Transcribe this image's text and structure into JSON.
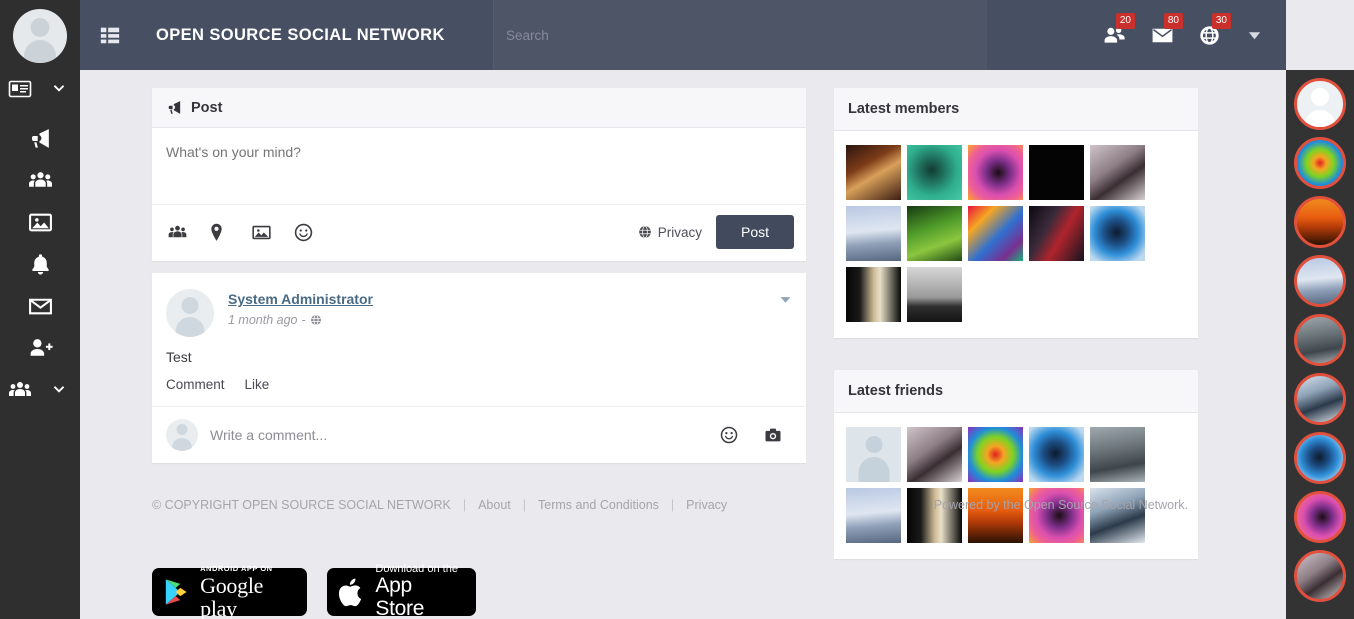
{
  "colors": {
    "header_bg": "#474f63",
    "search_bg": "#4e5567",
    "sidebar_bg": "#2f2f2f",
    "chat_strip_bg": "#333333",
    "page_bg": "#eaeaee",
    "badge_red": "#c9302c",
    "post_button_bg": "#424a5e",
    "link_blue": "#4a6b86",
    "chat_avatar_ring": "#e0503c"
  },
  "header": {
    "menu_toggle_icon": "th-list-icon",
    "brand": "OPEN SOURCE SOCIAL NETWORK",
    "search": {
      "placeholder": "Search",
      "value": ""
    },
    "notifications": [
      {
        "name": "friend-requests",
        "icon": "friends-icon",
        "count": "20"
      },
      {
        "name": "messages",
        "icon": "envelope-icon",
        "count": "80"
      },
      {
        "name": "alerts",
        "icon": "bell-globe-icon",
        "count": "30"
      }
    ],
    "user_menu_icon": "caret-down-icon"
  },
  "sidebar": {
    "avatar": "user-placeholder-avatar",
    "items": [
      {
        "name": "newsfeed",
        "icon": "id-card-icon",
        "has_chevron": true
      },
      {
        "name": "announcements",
        "icon": "megaphone-icon",
        "has_chevron": false
      },
      {
        "name": "groups",
        "icon": "group-icon",
        "has_chevron": false
      },
      {
        "name": "photos",
        "icon": "image-icon",
        "has_chevron": false
      },
      {
        "name": "notifications",
        "icon": "bell-icon",
        "has_chevron": false
      },
      {
        "name": "messages",
        "icon": "envelope-icon",
        "has_chevron": false
      },
      {
        "name": "add-friend",
        "icon": "user-plus-icon",
        "has_chevron": false
      },
      {
        "name": "communities",
        "icon": "group-icon",
        "has_chevron": true
      }
    ]
  },
  "composer": {
    "title": "Post",
    "title_icon": "megaphone-icon",
    "placeholder": "What's on your mind?",
    "value": "",
    "actions": [
      {
        "name": "tag-friends",
        "icon": "friends-icon"
      },
      {
        "name": "add-location",
        "icon": "map-pin-icon"
      },
      {
        "name": "add-photo",
        "icon": "image-icon"
      },
      {
        "name": "add-emoji",
        "icon": "smiley-icon"
      }
    ],
    "privacy_label": "Privacy",
    "privacy_icon": "globe-icon",
    "post_button": "Post"
  },
  "post": {
    "author": "System Administrator",
    "time": "1 month ago",
    "time_separator": "-",
    "privacy_icon": "globe-icon",
    "menu_icon": "caret-down-icon",
    "body": "Test",
    "actions": [
      "Comment",
      "Like"
    ],
    "comment": {
      "placeholder": "Write a comment...",
      "value": ""
    },
    "comment_icons": [
      {
        "name": "emoji",
        "icon": "smiley-icon"
      },
      {
        "name": "photo",
        "icon": "camera-icon"
      }
    ]
  },
  "latest_members": {
    "title": "Latest members",
    "thumbs": [
      {
        "name": "member-1",
        "css": "linear-gradient(150deg,#2a1410 0%,#7d3c18 35%,#d8a05a 55%,#3a1d12 100%)"
      },
      {
        "name": "member-2",
        "css": "radial-gradient(circle at 45% 45%, #133b33 0%, #1f6f5c 28%, #2fae8e 60%, #48c9a6 100%)"
      },
      {
        "name": "member-3",
        "css": "radial-gradient(circle at 55% 50%, #1b0d14 0%, #7d2f8a 30%, #d94fb0 55%, #f06292 75%, #f9a825 100%)"
      },
      {
        "name": "member-4",
        "css": "#040404"
      },
      {
        "name": "member-5",
        "css": "linear-gradient(145deg,#cfc4c9 0%,#8e7f86 40%,#3a2e33 62%,#d8d2d4 100%)"
      },
      {
        "name": "member-6",
        "css": "linear-gradient(175deg,#b9c8e2 0%,#dfe6f1 45%,#8fa0b8 68%,#55667e 100%)"
      },
      {
        "name": "member-7",
        "css": "linear-gradient(160deg,#173a12 0%,#4f9c2a 40%,#8cc63f 68%,#1f4a15 100%)"
      },
      {
        "name": "member-8",
        "css": "linear-gradient(135deg,#e8123c 0%,#f5a623 25%,#2f6fd0 55%,#7a2f8f 80%,#18b07a 100%)"
      },
      {
        "name": "member-9",
        "css": "linear-gradient(120deg,#0a0a12 0%,#3c2a3a 35%,#b0242c 58%,#141420 100%)"
      },
      {
        "name": "member-10",
        "css": "radial-gradient(circle at 48% 48%, #0d1b2e 0%, #1d4f86 30%, #2f8fd8 55%, #bcd9f0 85%)"
      },
      {
        "name": "member-11",
        "css": "linear-gradient(90deg,#050505 0%,#1a1a1a 25%,#cbb892 50%,#e8e0c8 62%,#070707 100%)"
      },
      {
        "name": "member-12",
        "css": "linear-gradient(180deg,#d7d7d7 0%,#9a9a9a 55%,#2f2f2f 72%,#131313 100%)"
      }
    ]
  },
  "latest_friends": {
    "title": "Latest friends",
    "thumbs": [
      {
        "name": "friend-1",
        "css": "placeholder"
      },
      {
        "name": "friend-2",
        "css": "linear-gradient(145deg,#cfc4c9 0%,#8e7f86 40%,#3a2e33 62%,#d8d2d4 100%)"
      },
      {
        "name": "friend-3",
        "css": "radial-gradient(circle at 50% 50%, #e02020 0%, #f5a623 22%, #7ed321 45%, #1f8fd8 68%, #8b2fbe 100%)"
      },
      {
        "name": "friend-4",
        "css": "radial-gradient(circle at 48% 48%, #0d1b2e 0%, #1d4f86 30%, #2f8fd8 55%, #bcd9f0 85%)"
      },
      {
        "name": "friend-5",
        "css": "linear-gradient(170deg,#9fa9ae 0%,#6b7479 40%,#3e464b 70%,#aab3b8 100%)"
      },
      {
        "name": "friend-6",
        "css": "linear-gradient(175deg,#b9c8e2 0%,#dfe6f1 45%,#8fa0b8 68%,#55667e 100%)"
      },
      {
        "name": "friend-7",
        "css": "linear-gradient(90deg,#050505 0%,#1a1a1a 25%,#cbb892 50%,#e8e0c8 62%,#070707 100%)"
      },
      {
        "name": "friend-8",
        "css": "linear-gradient(180deg,#f08a1e 0%,#e85d10 40%,#b23a08 62%,#2a1204 100%)"
      },
      {
        "name": "friend-9",
        "css": "radial-gradient(circle at 55% 50%, #1b0d14 0%, #7d2f8a 30%, #d94fb0 55%, #f06292 75%, #f9a825 100%)"
      },
      {
        "name": "friend-10",
        "css": "linear-gradient(160deg,#d9e2ec 0%,#8fa3b8 35%,#2b3a4a 62%,#e2e8ef 100%)"
      }
    ]
  },
  "chat_strip": {
    "avatars": [
      {
        "name": "chat-avatar-1",
        "css": "placeholder"
      },
      {
        "name": "chat-avatar-2",
        "css": "radial-gradient(circle at 50% 50%, #e02020 0%, #f5a623 20%, #7ed321 42%, #1f8fd8 66%, #8b2fbe 100%)"
      },
      {
        "name": "chat-avatar-3",
        "css": "linear-gradient(180deg,#f08a1e 0%,#e85d10 40%,#b23a08 62%,#2a1204 100%)"
      },
      {
        "name": "chat-avatar-4",
        "css": "linear-gradient(175deg,#b9c8e2 0%,#dfe6f1 45%,#8fa0b8 68%,#55667e 100%)"
      },
      {
        "name": "chat-avatar-5",
        "css": "linear-gradient(170deg,#9fa9ae 0%,#6b7479 40%,#3e464b 70%,#aab3b8 100%)"
      },
      {
        "name": "chat-avatar-6",
        "css": "linear-gradient(160deg,#d9e2ec 0%,#8fa3b8 35%,#2b3a4a 62%,#e2e8ef 100%)"
      },
      {
        "name": "chat-avatar-7",
        "css": "radial-gradient(circle at 48% 48%, #0d1b2e 0%, #1d4f86 30%, #2f8fd8 55%, #bcd9f0 85%)"
      },
      {
        "name": "chat-avatar-8",
        "css": "radial-gradient(circle at 55% 50%, #1b0d14 0%, #7d2f8a 30%, #d94fb0 55%, #f06292 75%, #f9a825 100%)"
      },
      {
        "name": "chat-avatar-9",
        "css": "linear-gradient(145deg,#cfc4c9 0%,#8e7f86 40%,#3a2e33 62%,#d8d2d4 100%)"
      }
    ]
  },
  "footer": {
    "copyright": "© COPYRIGHT OPEN SOURCE SOCIAL NETWORK",
    "links": [
      "About",
      "Terms and Conditions",
      "Privacy"
    ],
    "separator": "|",
    "powered_by": "Powered by the Open Source Social Network.",
    "google_play": {
      "top": "Android app on",
      "main": "Google play"
    },
    "app_store": {
      "top": "Download on the",
      "main": "App Store"
    }
  }
}
